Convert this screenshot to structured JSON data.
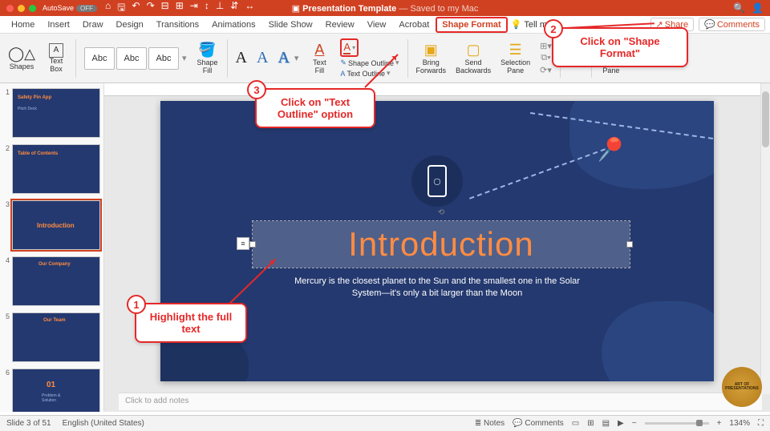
{
  "titlebar": {
    "autosave_label": "AutoSave",
    "autosave_state": "OFF",
    "doc_title": "Presentation Template",
    "saved_status": "— Saved to my Mac"
  },
  "tabs": {
    "items": [
      "Home",
      "Insert",
      "Draw",
      "Design",
      "Transitions",
      "Animations",
      "Slide Show",
      "Review",
      "View",
      "Acrobat"
    ],
    "shape_format": "Shape Format",
    "tell_me": "Tell me",
    "share": "Share",
    "comments": "Comments"
  },
  "ribbon": {
    "shapes": "Shapes",
    "text_box": "Text\nBox",
    "abc": "Abc",
    "shape_fill": "Shape\nFill",
    "text_fill": "Text\nFill",
    "shape_outline": "Shape Outline",
    "text_outline": "Text Outline",
    "bring_forwards": "Bring\nForwards",
    "send_backwards": "Send\nBackwards",
    "selection_pane": "Selection\nPane",
    "format_pane": "Format\nPane"
  },
  "slide": {
    "title": "Introduction",
    "body": "Mercury is the closest planet to the Sun and the smallest one in the Solar System—it's only a bit larger than the Moon",
    "notes_placeholder": "Click to add notes"
  },
  "thumbs": {
    "t1_title": "Safety Pin App",
    "t1_sub": "Pitch Deck",
    "t2_title": "Table of Contents",
    "t3_title": "Introduction",
    "t4_title": "Our Company",
    "t5_title": "Our Team",
    "t6_title": "01",
    "t6_sub": "Problem &\nSolution"
  },
  "status": {
    "slide_info": "Slide 3 of 51",
    "language": "English (United States)",
    "notes": "Notes",
    "comments": "Comments",
    "zoom": "134%"
  },
  "callouts": {
    "c1_num": "1",
    "c1_text": "Highlight the full text",
    "c2_num": "2",
    "c2_text": "Click on \"Shape Format\"",
    "c3_num": "3",
    "c3_text": "Click on \"Text Outline\" option"
  },
  "watermark": "ART OF\nPRESENTATIONS"
}
